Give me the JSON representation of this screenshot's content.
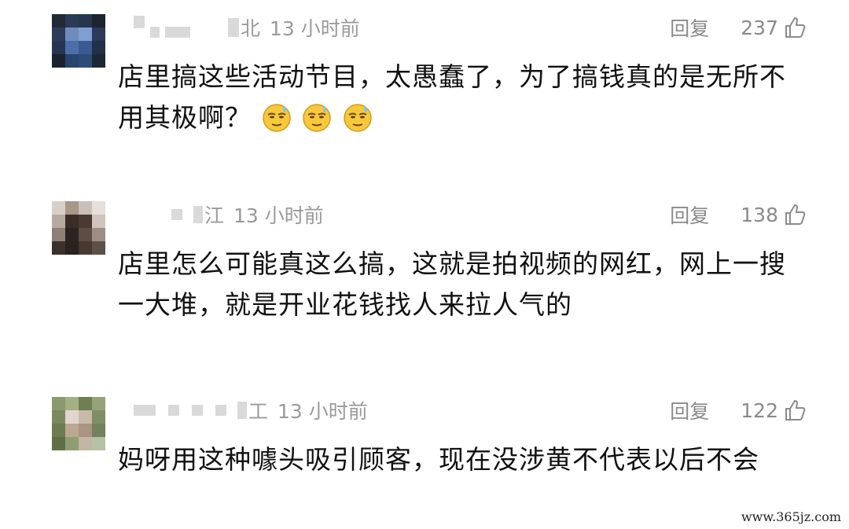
{
  "comments": [
    {
      "location_suffix": "北",
      "time": "13 小时前",
      "reply_label": "回复",
      "likes": "237",
      "text": "店里搞这些活动节目，太愚蠢了，为了搞钱真的是无所不用其极啊？",
      "emoji": [
        "sweat-smile-emoji",
        "sweat-smile-emoji",
        "sweat-smile-emoji"
      ]
    },
    {
      "location_suffix": "江",
      "time": "13 小时前",
      "reply_label": "回复",
      "likes": "138",
      "text": "店里怎么可能真这么搞，这就是拍视频的网红，网上一搜一大堆，就是开业花钱找人来拉人气的"
    },
    {
      "location_suffix": "工",
      "time": "13 小时前",
      "reply_label": "回复",
      "likes": "122",
      "text": "妈呀用这种噱头吸引顾客，现在没涉黄不代表以后不会"
    }
  ],
  "watermark": "www.365jz.com",
  "colors": {
    "meta_gray": "#9a9a9a",
    "text": "#111111",
    "blur_gray": "#d9d9d9"
  }
}
